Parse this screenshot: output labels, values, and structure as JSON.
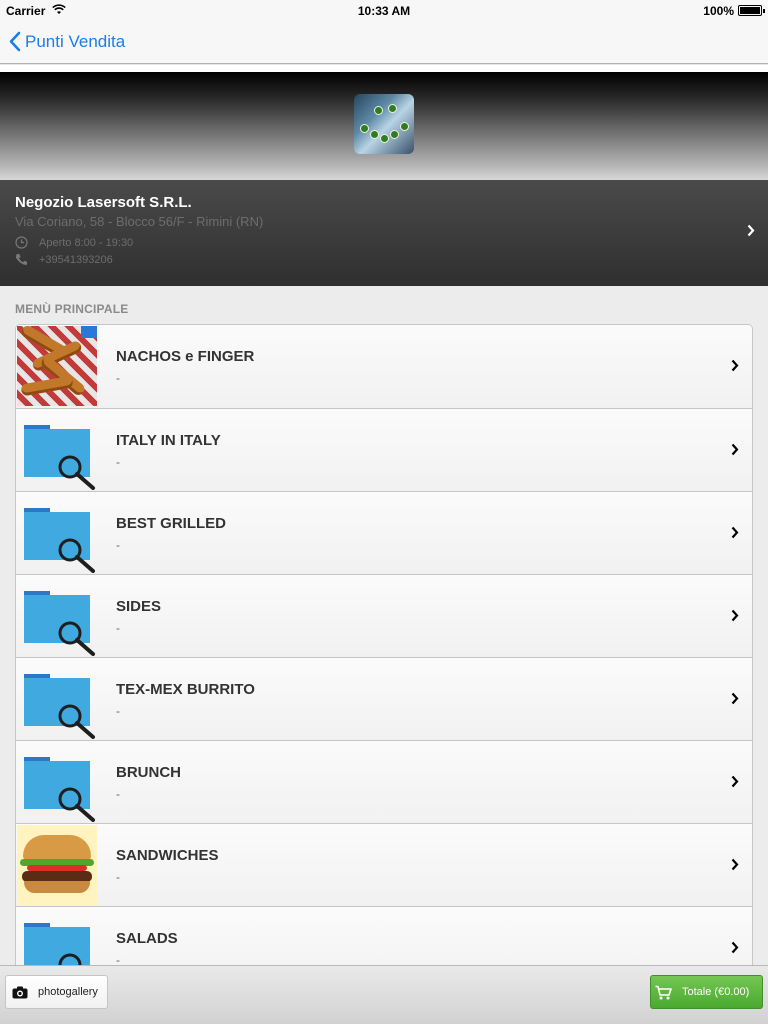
{
  "status_bar": {
    "carrier": "Carrier",
    "time": "10:33 AM",
    "battery": "100%"
  },
  "nav": {
    "back_label": "Punti Vendita"
  },
  "store": {
    "name": "Negozio Lasersoft S.R.L.",
    "address": "Via Coriano, 58 - Blocco 56/F - Rimini (RN)",
    "hours": "Aperto 8:00 - 19:30",
    "phone": "+39541393206"
  },
  "section": {
    "title": "MENÙ PRINCIPALE"
  },
  "menu_items": [
    {
      "title": "NACHOS e FINGER",
      "subtitle": "-",
      "icon": "food-photo"
    },
    {
      "title": "ITALY IN ITALY",
      "subtitle": "-",
      "icon": "folder-search-icon"
    },
    {
      "title": "BEST GRILLED",
      "subtitle": "-",
      "icon": "folder-search-icon"
    },
    {
      "title": "SIDES",
      "subtitle": "-",
      "icon": "folder-search-icon"
    },
    {
      "title": "TEX-MEX BURRITO",
      "subtitle": "-",
      "icon": "folder-search-icon"
    },
    {
      "title": "BRUNCH",
      "subtitle": "-",
      "icon": "folder-search-icon"
    },
    {
      "title": "SANDWICHES",
      "subtitle": "-",
      "icon": "burger-photo"
    },
    {
      "title": "SALADS",
      "subtitle": "-",
      "icon": "folder-search-icon"
    }
  ],
  "bottom_bar": {
    "gallery_label": "photogallery",
    "cart_label": "Totale (€0.00)"
  },
  "colors": {
    "accent": "#1a7dea",
    "folder": "#3fa9e0",
    "cart_green": "#4aa92f"
  }
}
